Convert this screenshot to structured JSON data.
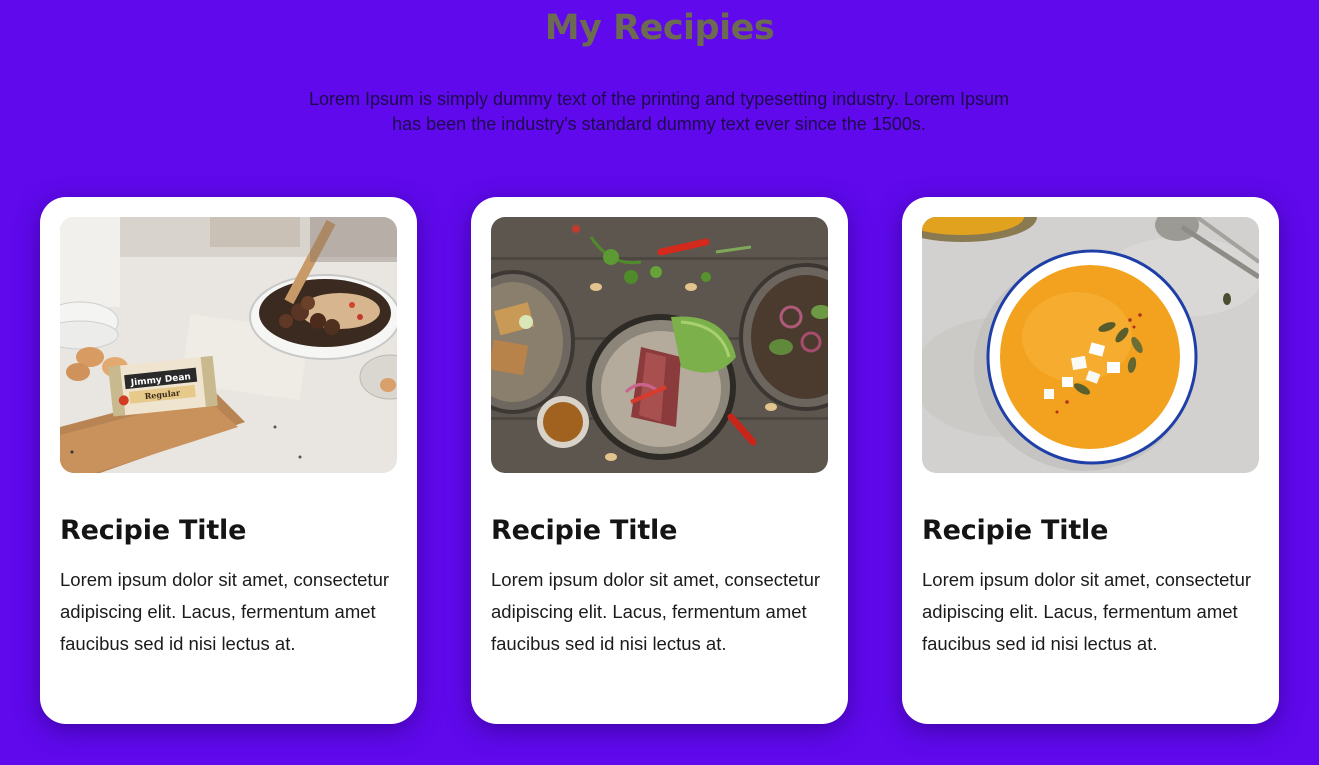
{
  "header": {
    "title": "My Recipies",
    "intro": "Lorem Ipsum is simply dummy text of the printing and typesetting industry. Lorem Ipsum has been the industry's standard dummy text ever since the 1500s."
  },
  "cards": [
    {
      "image": "breakfast-skillet-photo",
      "title": "Recipie Title",
      "text": "Lorem ipsum dolor sit amet, consectetur adipiscing elit. Lacus, fermentum amet faucibus sed id nisi lectus at.",
      "package_label_1": "Jimmy Dean",
      "package_label_2": "Regular"
    },
    {
      "image": "steak-bowls-photo",
      "title": "Recipie Title",
      "text": "Lorem ipsum dolor sit amet, consectetur adipiscing elit. Lacus, fermentum amet faucibus sed id nisi lectus at."
    },
    {
      "image": "pumpkin-soup-photo",
      "title": "Recipie Title",
      "text": "Lorem ipsum dolor sit amet, consectetur adipiscing elit. Lacus, fermentum amet faucibus sed id nisi lectus at."
    }
  ],
  "colors": {
    "background": "#5f09ec",
    "title": "#6d6a52",
    "card": "#ffffff",
    "heading": "#141414"
  }
}
